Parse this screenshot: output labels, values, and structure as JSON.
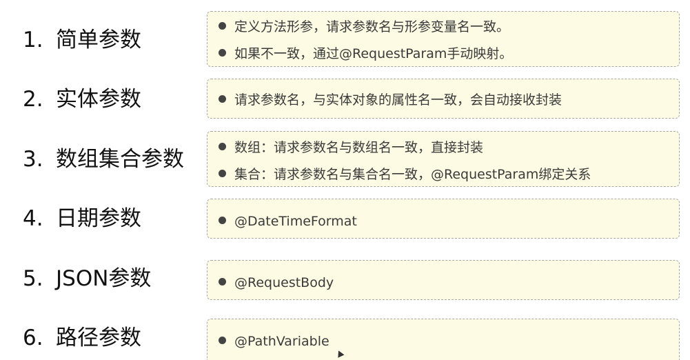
{
  "sections": [
    {
      "num": "1.",
      "title": "简单参数",
      "items": [
        "定义方法形参，请求参数名与形参变量名一致。",
        "如果不一致，通过@RequestParam手动映射。"
      ]
    },
    {
      "num": "2.",
      "title": "实体参数",
      "items": [
        "请求参数名，与实体对象的属性名一致，会自动接收封装"
      ]
    },
    {
      "num": "3.",
      "title": "数组集合参数",
      "items": [
        "数组：请求参数名与数组名一致，直接封装",
        "集合：请求参数名与集合名一致，@RequestParam绑定关系"
      ]
    },
    {
      "num": "4.",
      "title": "日期参数",
      "items": [
        "@DateTimeFormat"
      ]
    },
    {
      "num": "5.",
      "title": "JSON参数",
      "items": [
        "@RequestBody"
      ]
    },
    {
      "num": "6.",
      "title": "路径参数",
      "items": [
        "@PathVariable"
      ]
    }
  ]
}
